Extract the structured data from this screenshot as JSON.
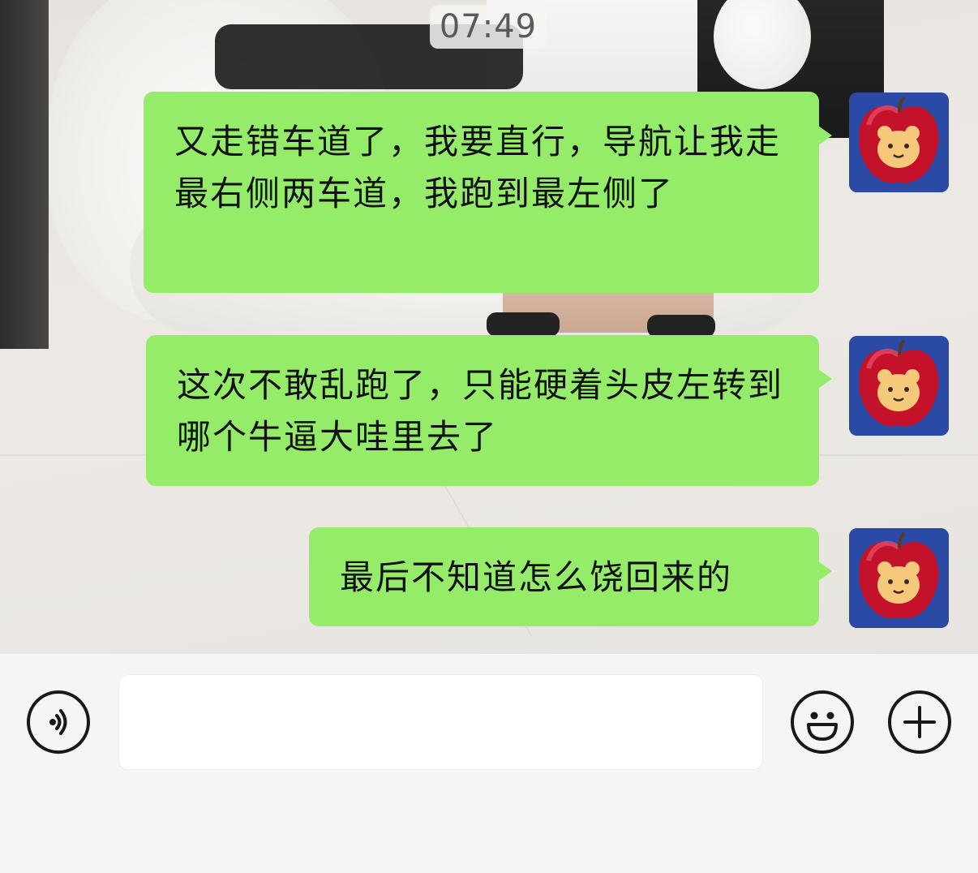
{
  "chat": {
    "timestamp": "07:49",
    "messages": [
      {
        "sender": "me",
        "text": "又走错车道了，我要直行，导航让我走最右侧两车道，我跑到最左侧了"
      },
      {
        "sender": "me",
        "text": "这次不敢乱跑了，只能硬着头皮左转到哪个牛逼大哇里去了"
      },
      {
        "sender": "me",
        "text": "最后不知道怎么饶回来的"
      }
    ],
    "avatar_icon": "apple-bear-avatar"
  },
  "input_bar": {
    "input_value": "",
    "placeholder": "",
    "voice_icon": "voice-icon",
    "emoji_icon": "emoji-icon",
    "plus_icon": "plus-icon"
  },
  "colors": {
    "bubble_green": "#95ec69",
    "avatar_background": "#2b4aa6",
    "input_bar_background": "#f5f5f5"
  }
}
